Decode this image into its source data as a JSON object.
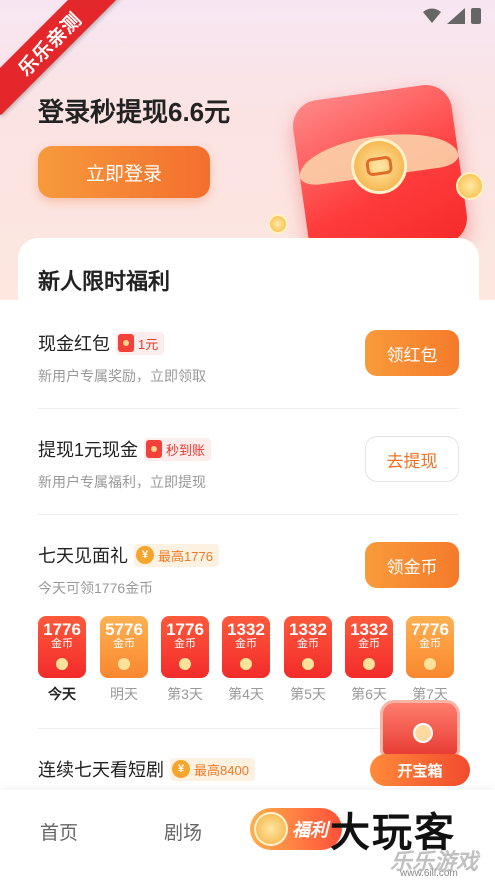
{
  "ribbon": {
    "text": "乐乐亲测"
  },
  "hero": {
    "title": "登录秒提现6.6元",
    "login_button": "立即登录"
  },
  "card": {
    "title": "新人限时福利",
    "tasks": [
      {
        "name": "现金红包",
        "badge": "1元",
        "desc": "新用户专属奖励，立即领取",
        "button": "领红包"
      },
      {
        "name": "提现1元现金",
        "badge": "秒到账",
        "desc": "新用户专属福利，立即提现",
        "button": "去提现"
      },
      {
        "name": "七天见面礼",
        "badge": "最高1776",
        "desc": "今天可领1776金币",
        "button": "领金币"
      },
      {
        "name": "连续七天看短剧",
        "badge": "最高8400"
      }
    ],
    "coin_symbol": "¥",
    "days": [
      {
        "amount": "1776",
        "unit": "金币",
        "label": "今天"
      },
      {
        "amount": "5776",
        "unit": "金币",
        "label": "明天"
      },
      {
        "amount": "1776",
        "unit": "金币",
        "label": "第3天"
      },
      {
        "amount": "1332",
        "unit": "金币",
        "label": "第4天"
      },
      {
        "amount": "1332",
        "unit": "金币",
        "label": "第5天"
      },
      {
        "amount": "1332",
        "unit": "金币",
        "label": "第6天"
      },
      {
        "amount": "7776",
        "unit": "金币",
        "label": "第7天"
      }
    ]
  },
  "treasure": {
    "label": "开宝箱"
  },
  "tabbar": {
    "home": "首页",
    "theater": "剧场",
    "welfare": "福利"
  },
  "watermark": {
    "big": "大玩客",
    "small": "乐乐游戏",
    "url": "www.6ill.com"
  },
  "colors": {
    "accent": "#f57a2a",
    "red": "#f22b2b"
  }
}
